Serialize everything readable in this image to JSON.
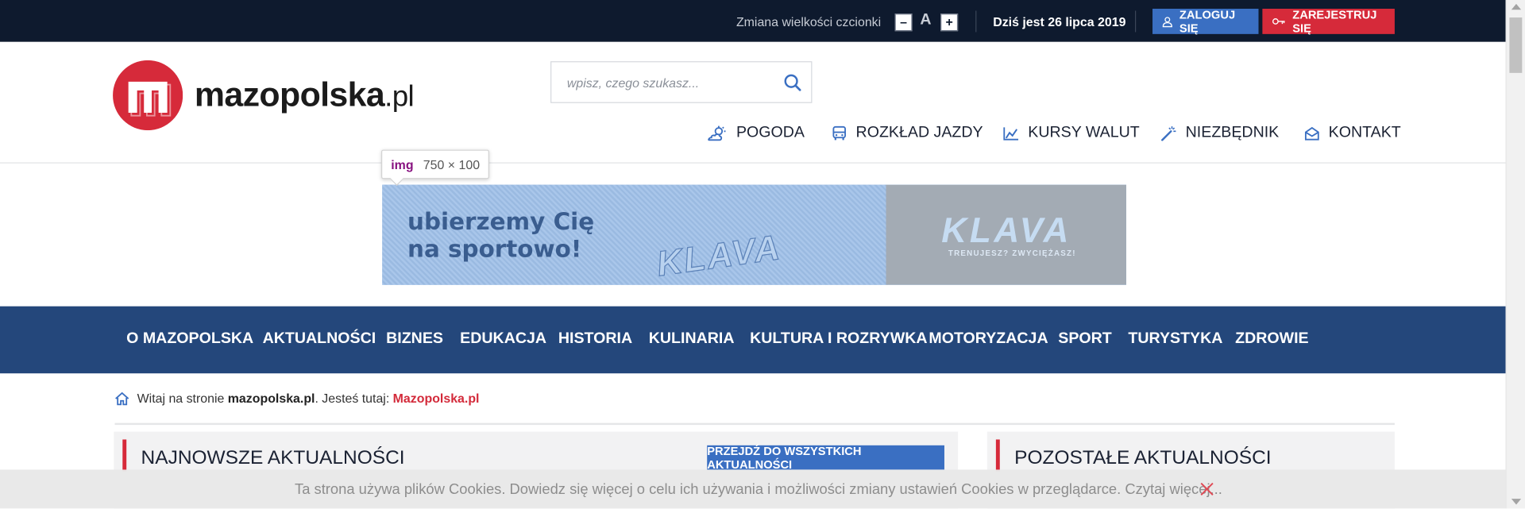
{
  "topbar": {
    "font_size_label": "Zmiana wielkości czcionki",
    "font_decrease": "–",
    "font_reset": "A",
    "font_increase": "+",
    "date": "Dziś jest 26 lipca 2019",
    "login": "ZALOGUJ SIĘ",
    "register": "ZAREJESTRUJ SIĘ"
  },
  "header": {
    "logo_main": "mazopolska",
    "logo_tld": ".pl",
    "search_placeholder": "wpisz, czego szukasz...",
    "services": [
      {
        "label": "POGODA",
        "icon": "weather-icon"
      },
      {
        "label": "ROZKŁAD JAZDY",
        "icon": "bus-icon"
      },
      {
        "label": "KURSY WALUT",
        "icon": "chart-icon"
      },
      {
        "label": "NIEZBĘDNIK",
        "icon": "magic-wand-icon"
      },
      {
        "label": "KONTAKT",
        "icon": "envelope-icon"
      }
    ]
  },
  "inspector_tooltip": {
    "tag": "img",
    "dimensions": "750 × 100"
  },
  "banner": {
    "slogan_line1": "ubierzemy Cię",
    "slogan_line2": "na sportowo!",
    "fabric_print": "KLAVA",
    "brand": "KLAVA",
    "tagline": "TRENUJESZ? ZWYCIĘŻASZ!"
  },
  "nav": {
    "categories": [
      "O MAZOPOLSKA",
      "AKTUALNOŚCI",
      "BIZNES",
      "EDUKACJA",
      "HISTORIA",
      "KULINARIA",
      "KULTURA I ROZRYWKA",
      "MOTORYZACJA",
      "SPORT",
      "TURYSTYKA",
      "ZDROWIE"
    ]
  },
  "breadcrumb": {
    "prefix": "Witaj na stronie ",
    "site": "mazopolska.pl",
    "middle": ". Jesteś tutaj: ",
    "current": "Mazopolska.pl"
  },
  "sections": {
    "latest_title": "NAJNOWSZE AKTUALNOŚCI",
    "latest_button": "PRZEJDŹ DO WSZYSTKICH AKTUALNOŚCI",
    "other_title": "POZOSTAŁE AKTUALNOŚCI"
  },
  "cookie": {
    "message": "Ta strona używa plików Cookies. Dowiedz się więcej o celu ich używania i możliwości zmiany ustawień Cookies w przeglądarce. Czytaj więcej..."
  },
  "colors": {
    "topbar_bg": "#0e1a2e",
    "nav_bg": "#24477b",
    "accent_red": "#d62a3a",
    "accent_blue": "#3a6fc2"
  }
}
